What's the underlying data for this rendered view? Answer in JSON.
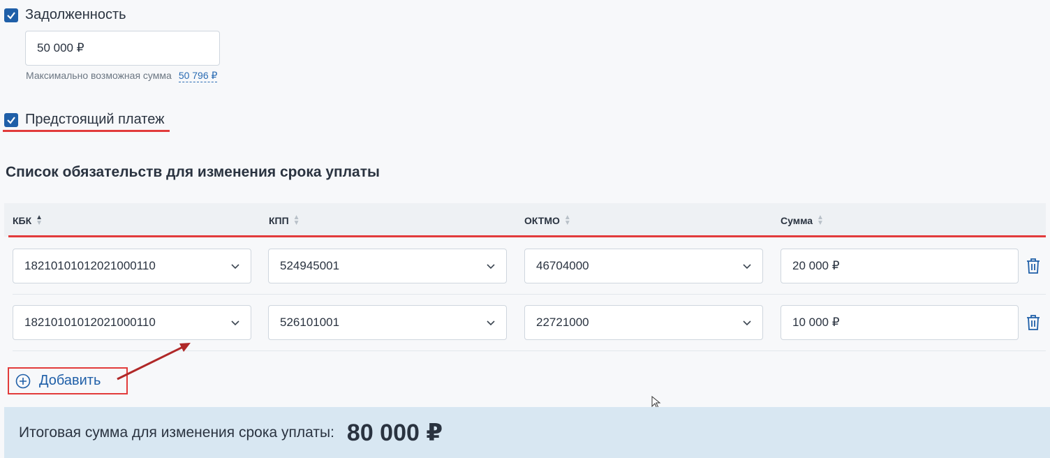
{
  "debt": {
    "checkbox_label": "Задолженность",
    "amount": "50 000  ₽",
    "hint_text": "Максимально возможная сумма",
    "hint_link": "50 796 ₽"
  },
  "upcoming": {
    "checkbox_label": "Предстоящий платеж"
  },
  "section_title": "Список обязательств для изменения срока уплаты",
  "table": {
    "headers": [
      "КБК",
      "КПП",
      "ОКТМО",
      "Сумма"
    ],
    "rows": [
      {
        "kbk": "18210101012021000110",
        "kpp": "524945001",
        "oktmo": "46704000",
        "sum": "20 000  ₽"
      },
      {
        "kbk": "18210101012021000110",
        "kpp": "526101001",
        "oktmo": "22721000",
        "sum": "10 000  ₽"
      }
    ]
  },
  "add_button": "Добавить",
  "total": {
    "label": "Итоговая сумма для изменения срока уплаты:",
    "value": "80 000 ₽"
  },
  "colors": {
    "accent": "#1f5fa8",
    "annotation_red": "#e23b3b",
    "total_bg": "#d8e7f2"
  }
}
